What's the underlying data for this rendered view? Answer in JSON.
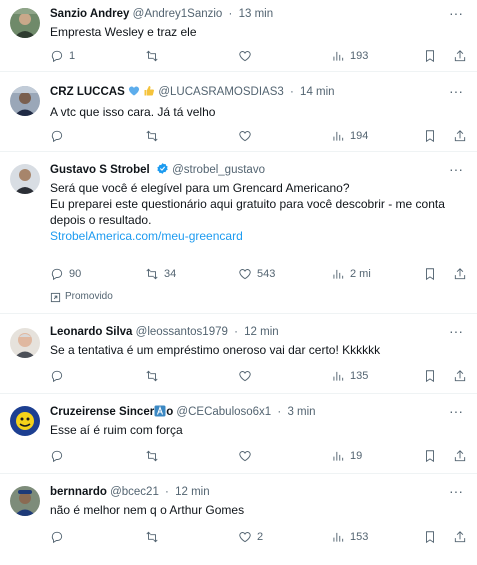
{
  "tweets": [
    {
      "name": "Sanzio Andrey",
      "handle": "@Andrey1Sanzio",
      "time": "13 min",
      "lines": [
        "Empresta Wesley e traz ele"
      ],
      "reply_count": "1",
      "retweet_count": "",
      "like_count": "",
      "view_count": "193"
    },
    {
      "name": "CRZ LUCCAS",
      "handle": "@LUCASRAMOSDIAS3",
      "time": "14 min",
      "lines": [
        "A vtc que isso cara.  Já tá velho"
      ],
      "reply_count": "",
      "retweet_count": "",
      "like_count": "",
      "view_count": "194"
    },
    {
      "name": "Gustavo S Strobel",
      "handle": "@strobel_gustavo",
      "time": "",
      "lines": [
        "Será que você é elegível para um Grencard Americano?",
        "Eu preparei este questionário aqui gratuito para você descobrir - me conta",
        "depois o resultado."
      ],
      "link": "StrobelAmerica.com/meu-greencard",
      "reply_count": "90",
      "retweet_count": "34",
      "like_count": "543",
      "view_count": "2 mi",
      "promoted_label": "Promovido"
    },
    {
      "name": "Leonardo Silva",
      "handle": "@leossantos1979",
      "time": "12 min",
      "lines": [
        "Se a tentativa é um empréstimo oneroso vai dar certo! Kkkkkk"
      ],
      "reply_count": "",
      "retweet_count": "",
      "like_count": "",
      "view_count": "135"
    },
    {
      "name": "Cruzeirense Sincer",
      "name_suffix": "o",
      "handle": "@CECabuloso6x1",
      "time": "3 min",
      "lines": [
        "Esse aí é ruim com força"
      ],
      "reply_count": "",
      "retweet_count": "",
      "like_count": "",
      "view_count": "19"
    },
    {
      "name": "bernnardo",
      "handle": "@bcec21",
      "time": "12 min",
      "lines": [
        "não é melhor nem q o Arthur Gomes"
      ],
      "reply_count": "",
      "retweet_count": "",
      "like_count": "2",
      "view_count": "153"
    }
  ],
  "separator": "·",
  "more_glyph": "···",
  "colors": {
    "text": "#0f1419",
    "secondary": "#536471",
    "link": "#1d9bf0",
    "verified": "#1d9bf0",
    "divider": "#eff3f4"
  },
  "icons": [
    "reply-icon",
    "retweet-icon",
    "like-icon",
    "views-icon",
    "bookmark-icon",
    "share-icon",
    "more-icon",
    "verified-icon",
    "heart-emoji",
    "thumbs-up-emoji",
    "a-button-emoji",
    "promoted-icon"
  ]
}
